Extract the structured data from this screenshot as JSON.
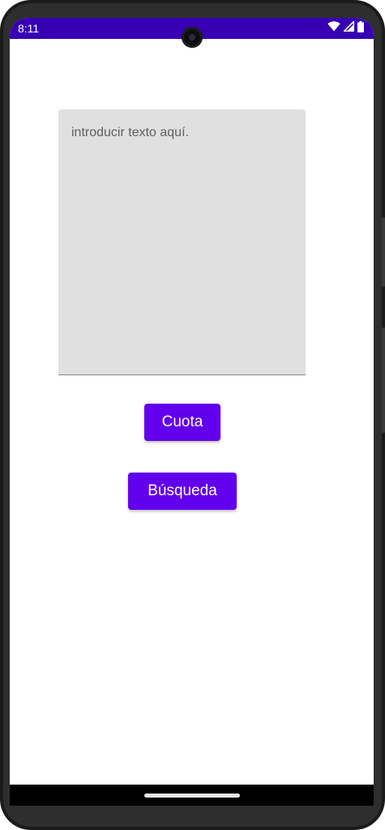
{
  "status_bar": {
    "time": "8:11",
    "background": "#3700b3",
    "icons": [
      "wifi-icon",
      "signal-icon",
      "battery-icon"
    ]
  },
  "main": {
    "text_input": {
      "value": "",
      "placeholder": "introducir texto aquí."
    },
    "cuota_label": "Cuota",
    "busqueda_label": "Búsqueda"
  },
  "colors": {
    "accent": "#6200ee",
    "input_background": "#e0e0e0"
  }
}
